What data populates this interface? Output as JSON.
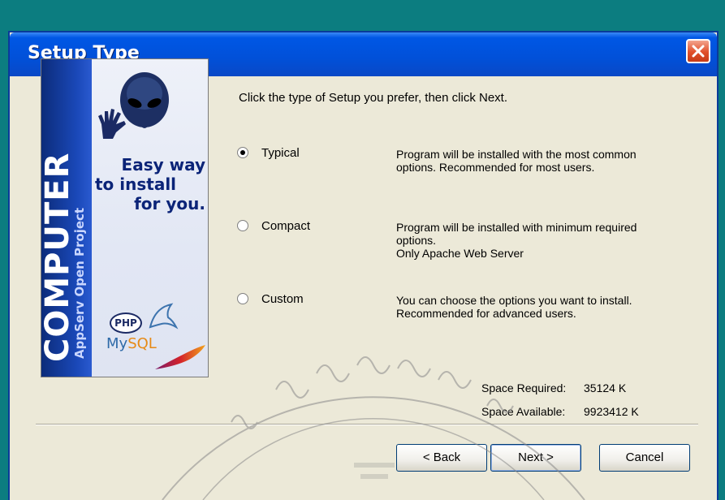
{
  "window": {
    "title": "Setup Type",
    "close_icon": "close-icon"
  },
  "banner": {
    "vertical_title": "COMPUTER",
    "vertical_subtitle": "AppServ Open Project",
    "tagline": [
      "Easy way",
      "to install",
      "for you."
    ],
    "php_logo_text": "PHP",
    "mysql_logo_text": "MySQL"
  },
  "content": {
    "prompt": "Click the type of Setup you prefer, then click Next.",
    "options": [
      {
        "label": "Typical",
        "checked": true,
        "description": [
          "Program will be installed with the most common",
          "options. Recommended for most users."
        ]
      },
      {
        "label": "Compact",
        "checked": false,
        "description": [
          "Program will be installed with minimum required",
          "options.",
          "Only Apache Web Server"
        ]
      },
      {
        "label": "Custom",
        "checked": false,
        "description": [
          "You can choose the options you want to install.",
          "Recommended for advanced users."
        ]
      }
    ],
    "space_required_label": "Space Required:",
    "space_required_value": "35124 K",
    "space_available_label": "Space Available:",
    "space_available_value": "9923412 K"
  },
  "buttons": {
    "back": "< Back",
    "next": "Next >",
    "cancel": "Cancel"
  },
  "colors": {
    "desktop": "#0c7d80",
    "titlebar": "#0150d8",
    "dialog": "#ece9d8"
  }
}
